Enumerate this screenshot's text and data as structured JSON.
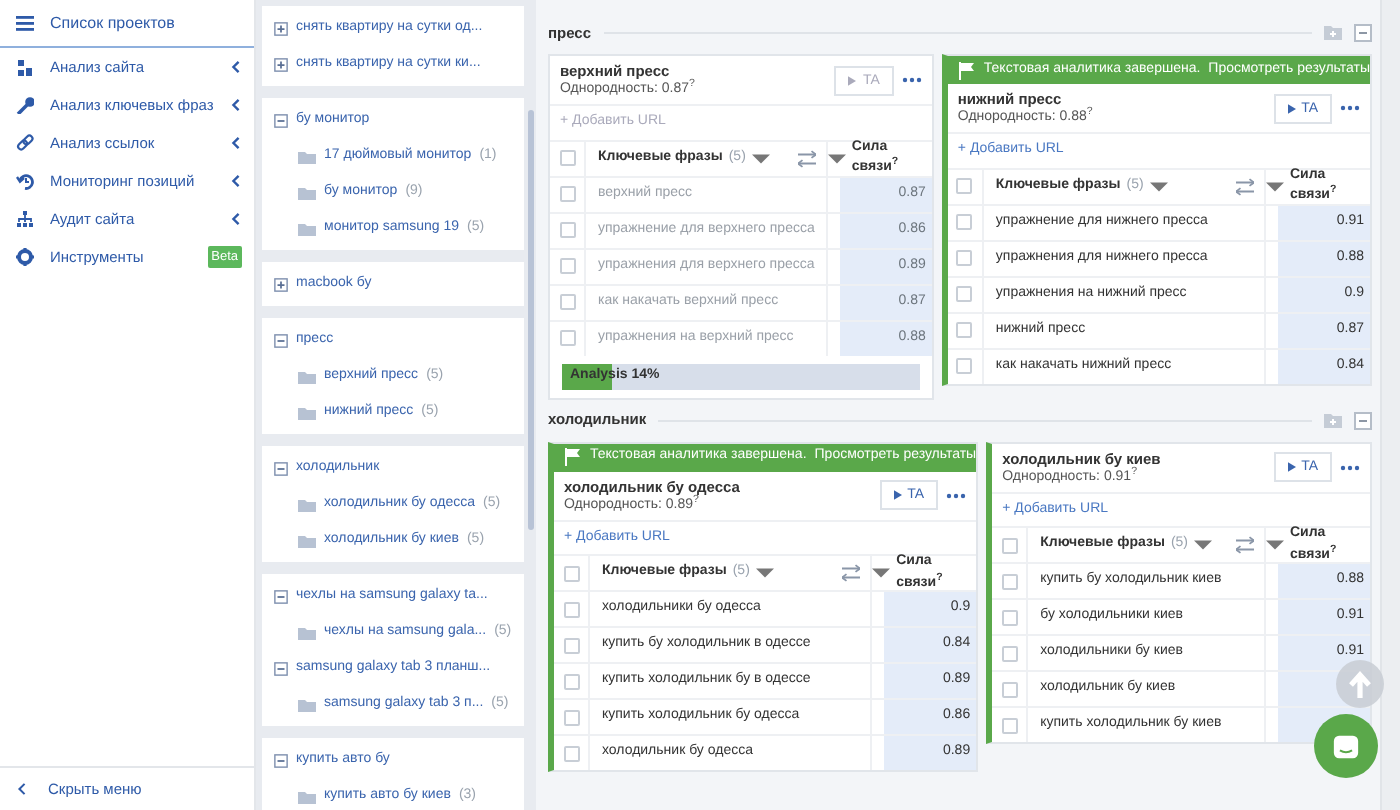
{
  "sidebar": {
    "header": {
      "label": "Список проектов",
      "selected": true
    },
    "items": [
      {
        "kind": "chart",
        "label": "Анализ сайта",
        "has_submenu": true
      },
      {
        "kind": "key",
        "label": "Анализ ключевых фраз",
        "has_submenu": true
      },
      {
        "kind": "link",
        "label": "Анализ ссылок",
        "has_submenu": true
      },
      {
        "kind": "monitor",
        "label": "Мониторинг позиций",
        "has_submenu": true
      },
      {
        "kind": "sitemap",
        "label": "Аудит сайта",
        "has_submenu": true
      },
      {
        "kind": "gear",
        "label": "Инструменты",
        "has_submenu": false,
        "badge": "Beta"
      }
    ],
    "hide_menu": "Скрыть меню"
  },
  "tree": {
    "blocks": [
      {
        "groups": [
          {
            "label": "снять квартиру на сутки од...",
            "expanded": false
          },
          {
            "label": "снять квартиру на сутки ки...",
            "expanded": false
          }
        ]
      },
      {
        "groups": [
          {
            "label": "бу монитор",
            "expanded": true,
            "children": [
              {
                "label": "17 дюймовый монитор",
                "count": "(1)"
              },
              {
                "label": "бу монитор",
                "count": "(9)"
              },
              {
                "label": "монитор samsung 19",
                "count": "(5)"
              }
            ]
          }
        ]
      },
      {
        "groups": [
          {
            "label": "macbook бу",
            "expanded": false
          }
        ]
      },
      {
        "groups": [
          {
            "label": "пресс",
            "expanded": true,
            "children": [
              {
                "label": "верхний пресс",
                "count": "(5)"
              },
              {
                "label": "нижний пресс",
                "count": "(5)"
              }
            ]
          }
        ]
      },
      {
        "groups": [
          {
            "label": "холодильник",
            "expanded": true,
            "children": [
              {
                "label": "холодильник бу одесса",
                "count": "(5)"
              },
              {
                "label": "холодильник бу киев",
                "count": "(5)"
              }
            ]
          }
        ]
      },
      {
        "groups": [
          {
            "label": "чехлы на samsung galaxy ta...",
            "expanded": true,
            "children": [
              {
                "label": "чехлы на samsung gala...",
                "count": "(5)"
              }
            ]
          },
          {
            "label": "samsung galaxy tab 3 планш...",
            "expanded": true,
            "children": [
              {
                "label": "samsung galaxy tab 3 п...",
                "count": "(5)"
              }
            ]
          }
        ]
      },
      {
        "groups": [
          {
            "label": "купить авто бу",
            "expanded": true,
            "children": [
              {
                "label": "купить авто бу киев",
                "count": "(3)"
              }
            ]
          }
        ]
      }
    ]
  },
  "sections": [
    {
      "title": "пресс",
      "cards": [
        {
          "kind": "analyzing",
          "select_all_checked": false,
          "title": "верхний пресс",
          "homogeneity": "Однородность: 0.87$^{?}$",
          "ta_button": "TA",
          "ta_enabled": false,
          "add_url": "+ Добавить URL",
          "columns": {
            "phrases": "Ключевые фразы",
            "count": "(5)",
            "strength": "Сила связи$^{?}$"
          },
          "rows": [
            {
              "phrase": "верхний пресс",
              "score": "0.87",
              "checked": false
            },
            {
              "phrase": "упражнение для верхнего пресса",
              "score": "0.86",
              "checked": false
            },
            {
              "phrase": "упражнения для верхнего пресса",
              "score": "0.89",
              "checked": false
            },
            {
              "phrase": "как накачать верхний пресс",
              "score": "0.87",
              "checked": false
            },
            {
              "phrase": "упражнения на верхний пресс",
              "score": "0.88",
              "checked": false
            }
          ],
          "progress": {
            "label": "Analysis 14%",
            "level": 0.14
          }
        },
        {
          "kind": "done",
          "select_all_checked": false,
          "banner": {
            "text": "Текстовая аналитика завершена.",
            "link": "Просмотреть результаты"
          },
          "title": "нижний пресс",
          "homogeneity": "Однородность: 0.88$^{?}$",
          "ta_button": "TA",
          "ta_enabled": true,
          "add_url": "+ Добавить URL",
          "columns": {
            "phrases": "Ключевые фразы",
            "count": "(5)",
            "strength": "Сила связи$^{?}$"
          },
          "rows": [
            {
              "phrase": "упражнение для нижнего пресса",
              "score": "0.91",
              "checked": false
            },
            {
              "phrase": "упражнения для нижнего пресса",
              "score": "0.88",
              "checked": false
            },
            {
              "phrase": "упражнения на нижний пресс",
              "score": "0.9",
              "checked": false
            },
            {
              "phrase": "нижний пресс",
              "score": "0.87",
              "checked": false
            },
            {
              "phrase": "как накачать нижний пресс",
              "score": "0.84",
              "checked": false
            }
          ]
        }
      ]
    },
    {
      "title": "холодильник",
      "cards": [
        {
          "kind": "done",
          "select_all_checked": false,
          "banner": {
            "text": "Текстовая аналитика завершена.",
            "link": "Просмотреть результаты"
          },
          "title": "холодильник бу одесса",
          "homogeneity": "Однородность: 0.89$^{?}$",
          "ta_button": "TA",
          "ta_enabled": true,
          "add_url": "+ Добавить URL",
          "columns": {
            "phrases": "Ключевые фразы",
            "count": "(5)",
            "strength": "Сила связи$^{?}$"
          },
          "rows": [
            {
              "phrase": "холодильники бу одесса",
              "score": "0.9",
              "checked": false
            },
            {
              "phrase": "купить бу холодильник в одессе",
              "score": "0.84",
              "checked": false
            },
            {
              "phrase": "купить холодильник бу в одессе",
              "score": "0.89",
              "checked": false
            },
            {
              "phrase": "купить холодильник бу одесса",
              "score": "0.86",
              "checked": false
            },
            {
              "phrase": "холодильник бу одесса",
              "score": "0.89",
              "checked": false
            }
          ]
        },
        {
          "kind": "done",
          "select_all_checked": false,
          "title": "холодильник бу киев",
          "homogeneity": "Однородность: 0.91$^{?}$",
          "ta_button": "TA",
          "ta_enabled": true,
          "add_url": "+ Добавить URL",
          "columns": {
            "phrases": "Ключевые фразы",
            "count": "(5)",
            "strength": "Сила связи$^{?}$"
          },
          "rows": [
            {
              "phrase": "купить бу холодильник киев",
              "score": "0.88",
              "checked": false
            },
            {
              "phrase": "бу холодильники киев",
              "score": "0.91",
              "checked": false
            },
            {
              "phrase": "холодильники бу киев",
              "score": "0.91",
              "checked": false
            },
            {
              "phrase": "холодильник бу киев",
              "checked": false
            },
            {
              "phrase": "купить холодильник бу киев",
              "checked": false
            }
          ]
        }
      ]
    }
  ]
}
